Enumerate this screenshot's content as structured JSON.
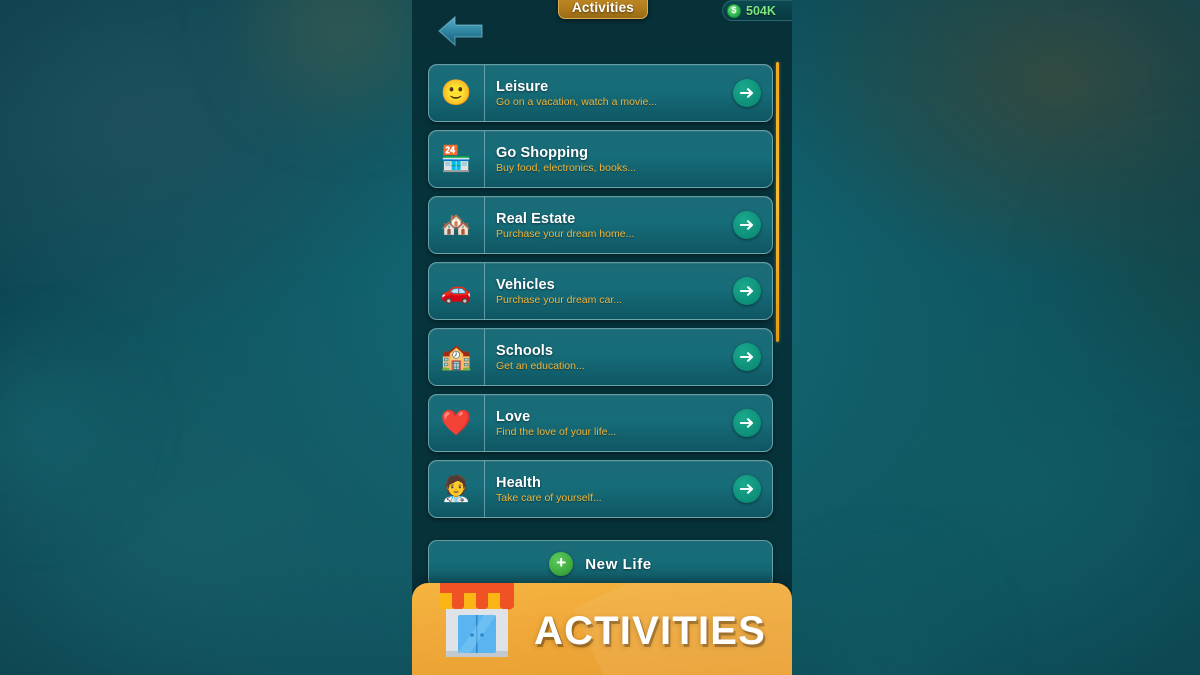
{
  "header": {
    "title_tab": "Activities",
    "back_icon": "back-arrow-icon",
    "money": {
      "icon": "dollar-coin-icon",
      "amount": "504K"
    }
  },
  "activities": [
    {
      "icon": "🙂",
      "icon_name": "smiley-face-icon",
      "title": "Leisure",
      "subtitle": "Go on a vacation, watch a movie...",
      "has_arrow": true
    },
    {
      "icon": "🏪",
      "icon_name": "shop-icon",
      "title": "Go Shopping",
      "subtitle": "Buy food, electronics, books...",
      "has_arrow": false
    },
    {
      "icon": "🏘️",
      "icon_name": "house-icon",
      "title": "Real Estate",
      "subtitle": "Purchase your dream home...",
      "has_arrow": true
    },
    {
      "icon": "🚗",
      "icon_name": "car-icon",
      "title": "Vehicles",
      "subtitle": "Purchase your dream car...",
      "has_arrow": true
    },
    {
      "icon": "🏫",
      "icon_name": "school-icon",
      "title": "Schools",
      "subtitle": "Get an education...",
      "has_arrow": true
    },
    {
      "icon": "❤️",
      "icon_name": "heart-icon",
      "title": "Love",
      "subtitle": "Find the love of your life...",
      "has_arrow": true
    },
    {
      "icon": "🧑‍⚕️",
      "icon_name": "health-head-icon",
      "title": "Health",
      "subtitle": "Take care of yourself...",
      "has_arrow": true
    }
  ],
  "new_life": {
    "label": "New Life",
    "plus": "+"
  },
  "banner": {
    "title": "ACTIVITIES",
    "icon_name": "shop-front-icon"
  },
  "scrollbar": {
    "name": "list-scrollbar"
  },
  "colors": {
    "accent_gold": "#f0b53c",
    "card_teal": "#166d79",
    "panel_dark": "#06333c",
    "banner_orange": "#f0a93a",
    "money_green": "#7de67d",
    "arrow_green": "#0e917a"
  }
}
